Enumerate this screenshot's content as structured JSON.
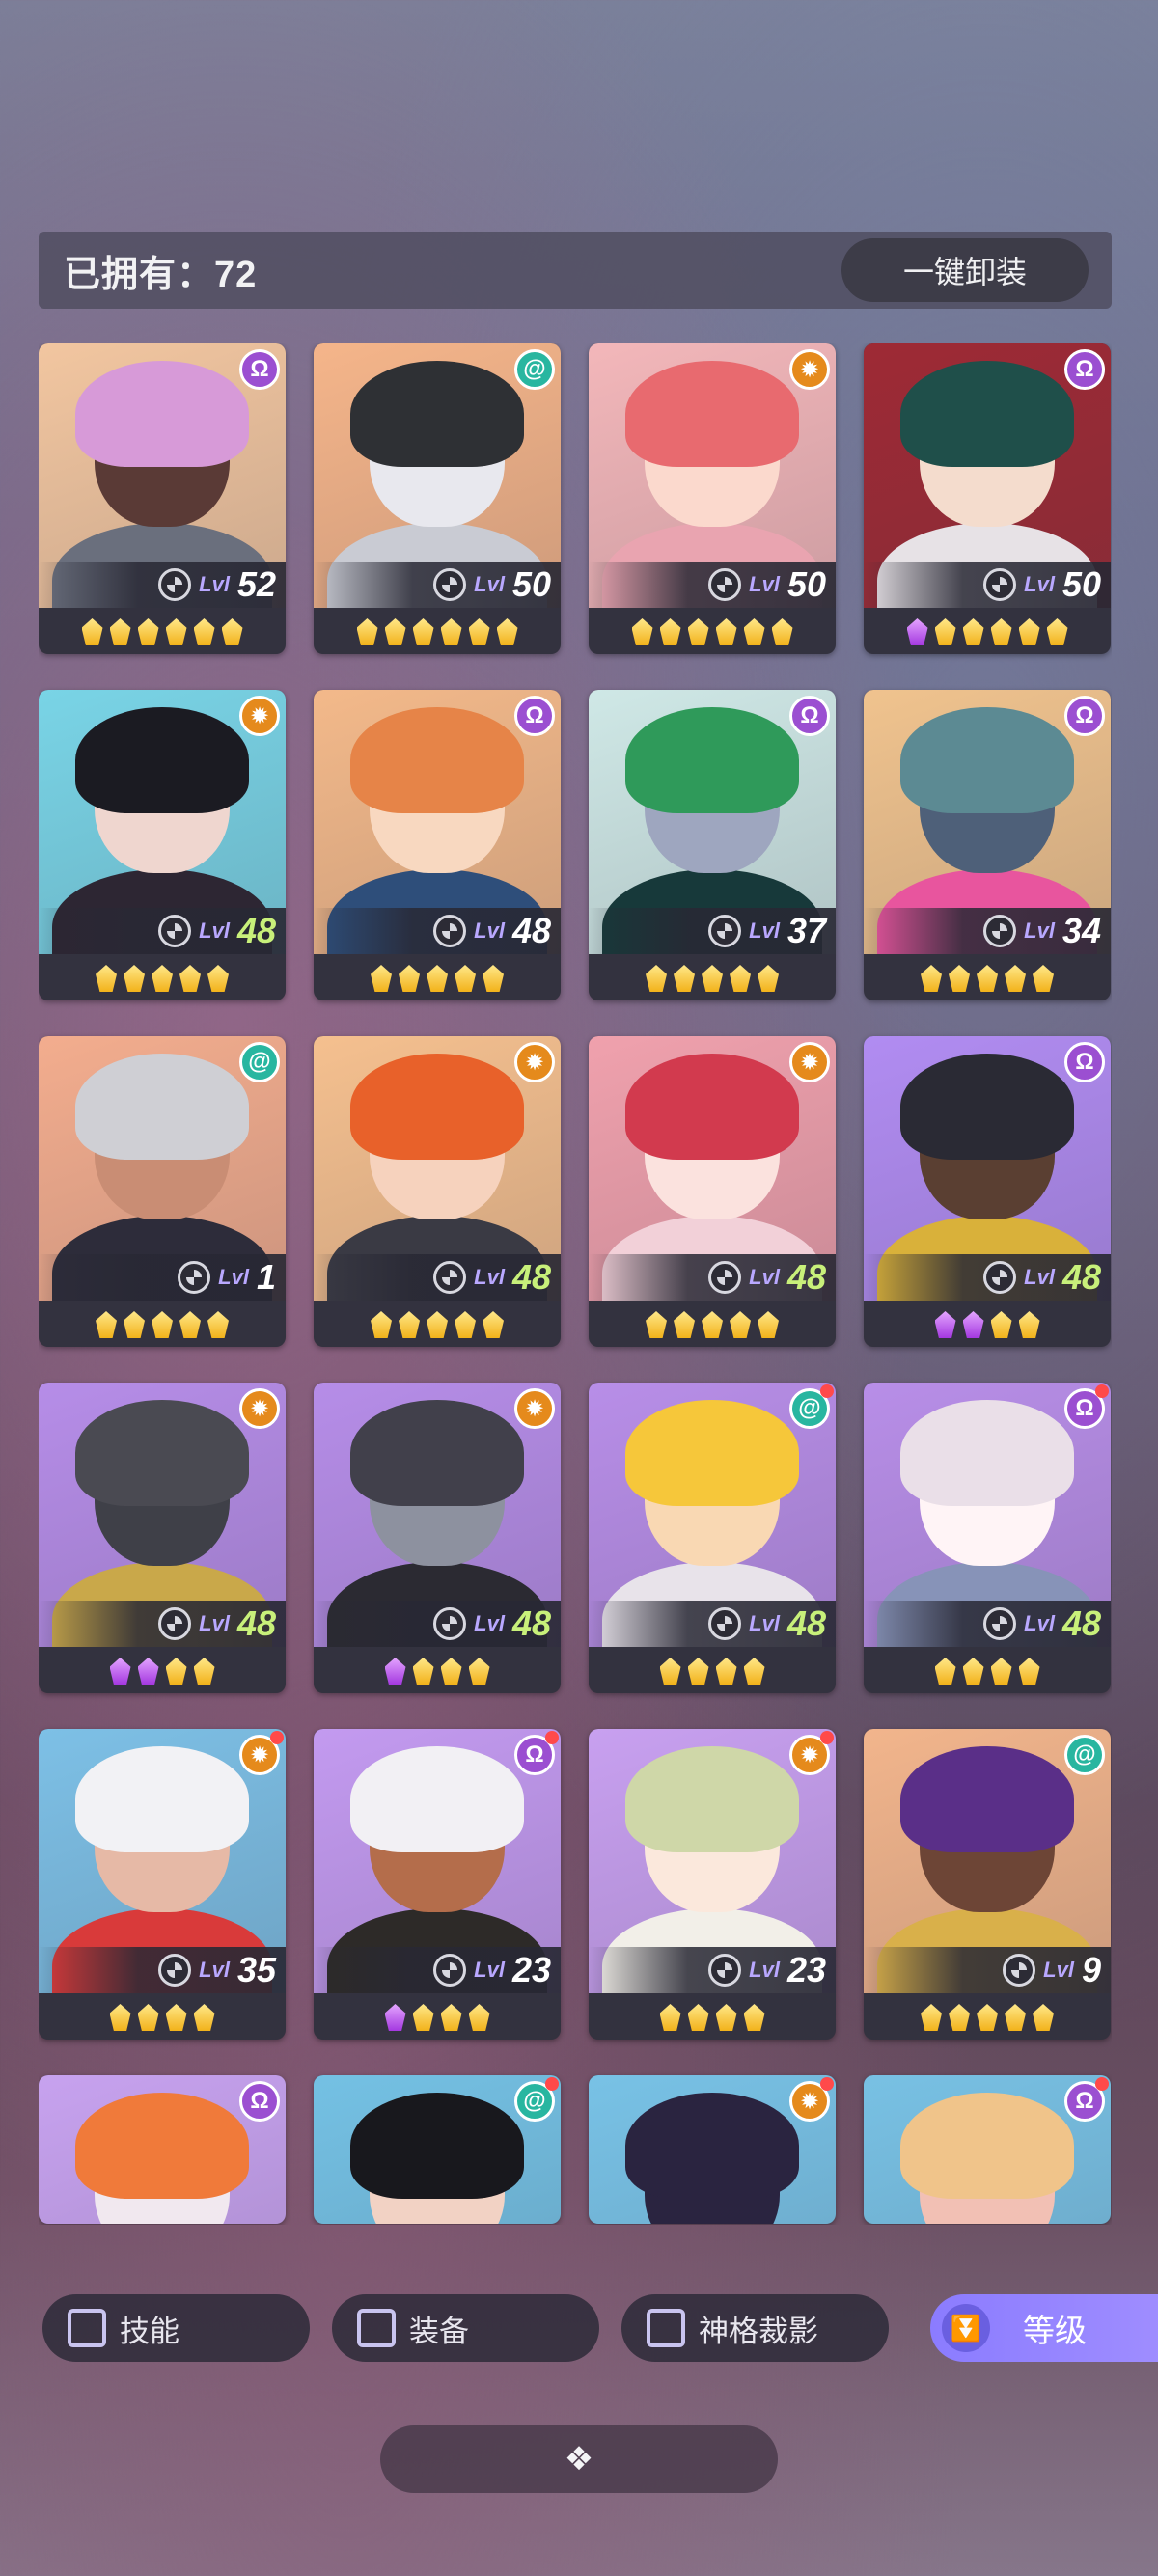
{
  "header": {
    "owned_label": "已拥有：72",
    "unequip_all_label": "一键卸装"
  },
  "heroes": [
    {
      "lvl_prefix": "Lvl",
      "level": "52",
      "faction": "Ω",
      "faction_color": "#9b4fd1",
      "gems": [
        "gold",
        "gold",
        "gold",
        "gold",
        "gold",
        "gold"
      ],
      "red_dot": false,
      "bg": "#f2c6a0",
      "hair": "#d79ad8",
      "skin": "#5a3a36",
      "cloth": "#6a6f7d",
      "max": false
    },
    {
      "lvl_prefix": "Lvl",
      "level": "50",
      "faction": "@",
      "faction_color": "#28b6a0",
      "gems": [
        "gold",
        "gold",
        "gold",
        "gold",
        "gold",
        "gold"
      ],
      "red_dot": false,
      "bg": "#f5b58a",
      "hair": "#2e3034",
      "skin": "#e8e8ee",
      "cloth": "#c9cbd3",
      "max": false
    },
    {
      "lvl_prefix": "Lvl",
      "level": "50",
      "faction": "✹",
      "faction_color": "#e58a1c",
      "gems": [
        "gold",
        "gold",
        "gold",
        "gold",
        "gold",
        "gold"
      ],
      "red_dot": false,
      "bg": "#f3b7ba",
      "hair": "#e86a6f",
      "skin": "#fbd9cd",
      "cloth": "#e9a4b0",
      "max": false
    },
    {
      "lvl_prefix": "Lvl",
      "level": "50",
      "faction": "Ω",
      "faction_color": "#9b4fd1",
      "gems": [
        "purple",
        "gold",
        "gold",
        "gold",
        "gold",
        "gold"
      ],
      "red_dot": false,
      "bg": "#9e2a35",
      "hair": "#1f4f4a",
      "skin": "#f4dccd",
      "cloth": "#e7e2e6",
      "max": false
    },
    {
      "lvl_prefix": "Lvl",
      "level": "48",
      "faction": "✹",
      "faction_color": "#e58a1c",
      "gems": [
        "gold",
        "gold",
        "gold",
        "gold",
        "gold"
      ],
      "red_dot": false,
      "bg": "#79d4e6",
      "hair": "#1b1b22",
      "skin": "#efd6cf",
      "cloth": "#2d2633",
      "max": true
    },
    {
      "lvl_prefix": "Lvl",
      "level": "48",
      "faction": "Ω",
      "faction_color": "#9b4fd1",
      "gems": [
        "gold",
        "gold",
        "gold",
        "gold",
        "gold"
      ],
      "red_dot": false,
      "bg": "#f3b98a",
      "hair": "#e68448",
      "skin": "#f8d8c0",
      "cloth": "#2e4e7a",
      "max": false
    },
    {
      "lvl_prefix": "Lvl",
      "level": "37",
      "faction": "Ω",
      "faction_color": "#9b4fd1",
      "gems": [
        "gold",
        "gold",
        "gold",
        "gold",
        "gold"
      ],
      "red_dot": false,
      "bg": "#cfe8e6",
      "hair": "#2f9a5a",
      "skin": "#9ea6bf",
      "cloth": "#17393a",
      "max": false
    },
    {
      "lvl_prefix": "Lvl",
      "level": "34",
      "faction": "Ω",
      "faction_color": "#9b4fd1",
      "gems": [
        "gold",
        "gold",
        "gold",
        "gold",
        "gold"
      ],
      "red_dot": false,
      "bg": "#f0c38e",
      "hair": "#5c8a93",
      "skin": "#4e6079",
      "cloth": "#e8559e",
      "max": false
    },
    {
      "lvl_prefix": "Lvl",
      "level": "1",
      "faction": "@",
      "faction_color": "#28b6a0",
      "gems": [
        "gold",
        "gold",
        "gold",
        "gold",
        "gold"
      ],
      "red_dot": false,
      "bg": "#f3ad8e",
      "hair": "#cfcfd4",
      "skin": "#c98d74",
      "cloth": "#2d2c3a",
      "max": false
    },
    {
      "lvl_prefix": "Lvl",
      "level": "48",
      "faction": "✹",
      "faction_color": "#e58a1c",
      "gems": [
        "gold",
        "gold",
        "gold",
        "gold",
        "gold"
      ],
      "red_dot": false,
      "bg": "#f5c08f",
      "hair": "#e8612a",
      "skin": "#f6d2bd",
      "cloth": "#3a3a44",
      "max": true
    },
    {
      "lvl_prefix": "Lvl",
      "level": "48",
      "faction": "✹",
      "faction_color": "#e58a1c",
      "gems": [
        "gold",
        "gold",
        "gold",
        "gold",
        "gold"
      ],
      "red_dot": false,
      "bg": "#f0a1ad",
      "hair": "#d23a4e",
      "skin": "#fbe2de",
      "cloth": "#f2d0d8",
      "max": true
    },
    {
      "lvl_prefix": "Lvl",
      "level": "48",
      "faction": "Ω",
      "faction_color": "#9b4fd1",
      "gems": [
        "purple",
        "purple",
        "gold",
        "gold"
      ],
      "red_dot": false,
      "bg": "#b18cf2",
      "hair": "#2a2a34",
      "skin": "#5a3f32",
      "cloth": "#d9b13a",
      "max": true
    },
    {
      "lvl_prefix": "Lvl",
      "level": "48",
      "faction": "✹",
      "faction_color": "#e58a1c",
      "gems": [
        "purple",
        "purple",
        "gold",
        "gold"
      ],
      "red_dot": false,
      "bg": "#b68de8",
      "hair": "#4a4a52",
      "skin": "#3f4048",
      "cloth": "#c9a84a",
      "max": true
    },
    {
      "lvl_prefix": "Lvl",
      "level": "48",
      "faction": "✹",
      "faction_color": "#e58a1c",
      "gems": [
        "purple",
        "gold",
        "gold",
        "gold"
      ],
      "red_dot": false,
      "bg": "#b68de8",
      "hair": "#41404b",
      "skin": "#8d919f",
      "cloth": "#2b2a32",
      "max": true
    },
    {
      "lvl_prefix": "Lvl",
      "level": "48",
      "faction": "@",
      "faction_color": "#28b6a0",
      "gems": [
        "gold",
        "gold",
        "gold",
        "gold"
      ],
      "red_dot": true,
      "bg": "#b88ee8",
      "hair": "#f6c73a",
      "skin": "#f9d8b3",
      "cloth": "#e8e3ea",
      "max": true
    },
    {
      "lvl_prefix": "Lvl",
      "level": "48",
      "faction": "Ω",
      "faction_color": "#9b4fd1",
      "gems": [
        "gold",
        "gold",
        "gold",
        "gold"
      ],
      "red_dot": true,
      "bg": "#b88ee8",
      "hair": "#eadfe8",
      "skin": "#fff4f6",
      "cloth": "#8793b8",
      "max": true
    },
    {
      "lvl_prefix": "Lvl",
      "level": "35",
      "faction": "✹",
      "faction_color": "#e58a1c",
      "gems": [
        "gold",
        "gold",
        "gold",
        "gold"
      ],
      "red_dot": true,
      "bg": "#7dc0e6",
      "hair": "#f2f2f5",
      "skin": "#e6b9a6",
      "cloth": "#d93a3a",
      "max": false
    },
    {
      "lvl_prefix": "Lvl",
      "level": "23",
      "faction": "Ω",
      "faction_color": "#9b4fd1",
      "gems": [
        "purple",
        "gold",
        "gold",
        "gold"
      ],
      "red_dot": true,
      "bg": "#c39af0",
      "hair": "#f2f0f4",
      "skin": "#b46d4b",
      "cloth": "#2d2a28",
      "max": false
    },
    {
      "lvl_prefix": "Lvl",
      "level": "23",
      "faction": "✹",
      "faction_color": "#e58a1c",
      "gems": [
        "gold",
        "gold",
        "gold",
        "gold"
      ],
      "red_dot": true,
      "bg": "#c8a0f0",
      "hair": "#cfd7a8",
      "skin": "#fbe8dc",
      "cloth": "#f2efe8",
      "max": false
    },
    {
      "lvl_prefix": "Lvl",
      "level": "9",
      "faction": "@",
      "faction_color": "#28b6a0",
      "gems": [
        "gold",
        "gold",
        "gold",
        "gold",
        "gold"
      ],
      "red_dot": false,
      "bg": "#f2b58c",
      "hair": "#5a2f88",
      "skin": "#6d4536",
      "cloth": "#d9b04a",
      "max": false
    },
    {
      "lvl_prefix": "",
      "level": "",
      "faction": "Ω",
      "faction_color": "#9b4fd1",
      "gems": [],
      "red_dot": false,
      "bg": "#c7a2ef",
      "hair": "#f07a3a",
      "skin": "#f1e8ef",
      "cloth": "#f0d9a8",
      "max": false
    },
    {
      "lvl_prefix": "",
      "level": "",
      "faction": "@",
      "faction_color": "#28b6a0",
      "gems": [],
      "red_dot": true,
      "bg": "#74c1e4",
      "hair": "#18181d",
      "skin": "#f2d2c4",
      "cloth": "#2a2a30",
      "max": false
    },
    {
      "lvl_prefix": "",
      "level": "",
      "faction": "✹",
      "faction_color": "#e58a1c",
      "gems": [],
      "red_dot": true,
      "bg": "#78c2e6",
      "hair": "#2a2440",
      "skin": "#2a2440",
      "cloth": "#2a2440",
      "max": false
    },
    {
      "lvl_prefix": "",
      "level": "",
      "faction": "Ω",
      "faction_color": "#9b4fd1",
      "gems": [],
      "red_dot": true,
      "bg": "#78c1e4",
      "hair": "#f0c48a",
      "skin": "#f2c0b4",
      "cloth": "#e5b6a8",
      "max": false
    }
  ],
  "filters": [
    {
      "label": "技能",
      "checked": false
    },
    {
      "label": "装备",
      "checked": false
    },
    {
      "label": "神格裁影",
      "checked": false
    }
  ],
  "sort": {
    "label": "等级",
    "icon": "double-chevron-down-icon"
  },
  "collapse": {
    "icon": "diamond-cluster-icon",
    "glyph": "❖"
  }
}
